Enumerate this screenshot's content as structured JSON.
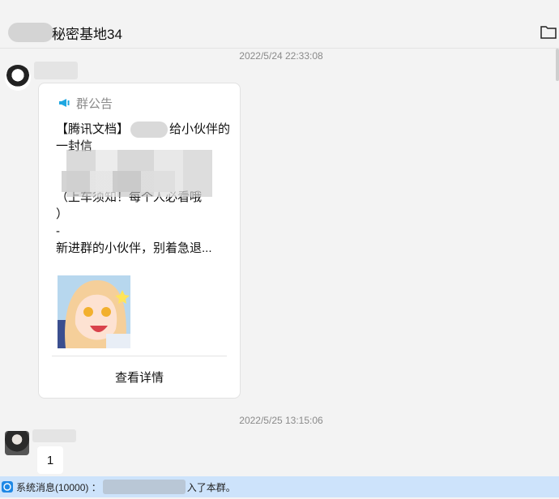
{
  "header": {
    "group_name": "秘密基地34",
    "folder_icon": "folder-icon"
  },
  "messages": [
    {
      "timestamp": "2022/5/24 22:33:08",
      "card": {
        "heading": "群公告",
        "heading_icon": "megaphone-icon",
        "line1_prefix": "【腾讯文档】",
        "line1_suffix": "给小伙伴的",
        "line2": "一封信",
        "line3": "（上车须知！每个人必看哦",
        "line4": "）",
        "line5": "-",
        "line6": "新进群的小伙伴，别着急退...",
        "link_label": "查看详情"
      }
    },
    {
      "timestamp": "2022/5/25 13:15:06",
      "text": "1"
    }
  ],
  "system": {
    "prefix": "系统消息(10000) ：",
    "suffix": "入了本群。",
    "icon": "system-info-icon"
  },
  "colors": {
    "system_bar": "#cde3fb",
    "accent": "#1e88e5"
  }
}
